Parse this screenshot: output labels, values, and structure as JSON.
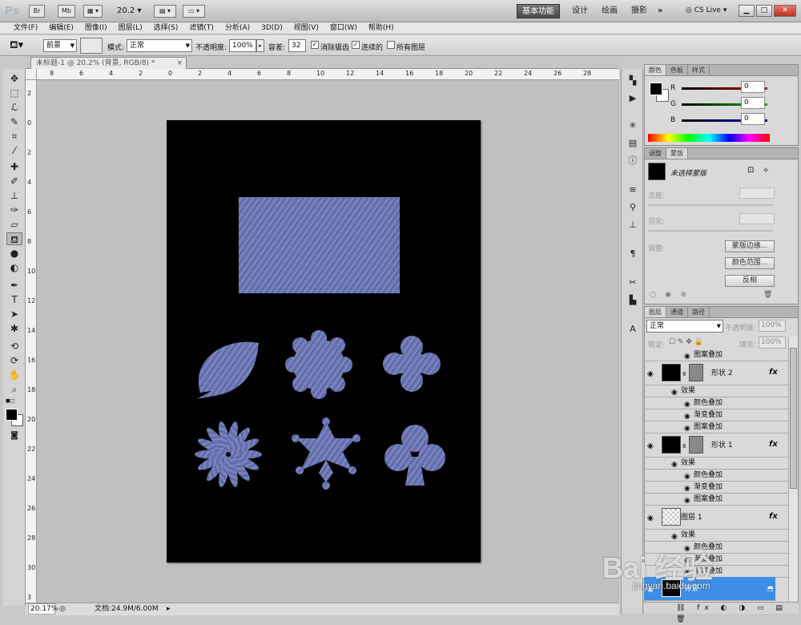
{
  "titlebar": {
    "app_logo": "Ps",
    "br_label": "Br",
    "mb_label": "Mb",
    "zoom_value": "20.2",
    "workspaces": [
      "基本功能",
      "设计",
      "绘画",
      "摄影"
    ],
    "more": "»",
    "cs_live": "CS Live",
    "window_controls": [
      "▁",
      "□",
      "✕"
    ]
  },
  "menubar": {
    "items": [
      "文件(F)",
      "编辑(E)",
      "图像(I)",
      "图层(L)",
      "选择(S)",
      "滤镜(T)",
      "分析(A)",
      "3D(D)",
      "视图(V)",
      "窗口(W)",
      "帮助(H)"
    ]
  },
  "options": {
    "fill_source": "前景",
    "mode_label": "模式:",
    "mode_value": "正常",
    "opacity_label": "不透明度:",
    "opacity_value": "100%",
    "tolerance_label": "容差:",
    "tolerance_value": "32",
    "antialias_label": "消除锯齿",
    "contiguous_label": "连续的",
    "all_layers_label": "所有图层"
  },
  "document_tab": {
    "title": "未标题-1 @ 20.2% (背景, RGB/8) *",
    "close": "×"
  },
  "ruler": {
    "h_labels": [
      "8",
      "6",
      "4",
      "2",
      "0",
      "2",
      "4",
      "6",
      "8",
      "10",
      "12",
      "14",
      "16",
      "18",
      "20",
      "22",
      "24",
      "26",
      "28"
    ],
    "v_labels": [
      "2",
      "0",
      "2",
      "4",
      "6",
      "8",
      "10",
      "12",
      "14",
      "16",
      "18",
      "20",
      "22",
      "24",
      "26",
      "28",
      "30",
      "3"
    ]
  },
  "status": {
    "zoom": "20.17%",
    "doc_info": "文档:24.9M/6.00M"
  },
  "color_panel": {
    "tabs": [
      "颜色",
      "色板",
      "样式"
    ],
    "channels": [
      {
        "name": "R",
        "value": "0",
        "color": "#c00000"
      },
      {
        "name": "G",
        "value": "0",
        "color": "#00b000"
      },
      {
        "name": "B",
        "value": "0",
        "color": "#0000c0"
      }
    ]
  },
  "masks_panel": {
    "tabs": [
      "调整",
      "蒙版"
    ],
    "no_mask": "未选择蒙版",
    "density_label": "浓度:",
    "feather_label": "羽化:",
    "refine_label": "调整:",
    "edge_button": "蒙版边缘...",
    "color_range_button": "颜色范围...",
    "invert_button": "反相"
  },
  "layers_panel": {
    "tabs": [
      "图层",
      "通道",
      "路径"
    ],
    "blend_mode": "正常",
    "opacity_label": "不透明度:",
    "opacity_value": "100%",
    "lock_label": "锁定:",
    "fill_label": "填充:",
    "fill_value": "100%",
    "fx": "fx",
    "rows": {
      "top_pattern": "图案叠加",
      "shape2": "形状 2",
      "shape2_effects": "效果",
      "shape2_color": "颜色叠加",
      "shape2_gradient": "渐变叠加",
      "shape2_pattern": "图案叠加",
      "shape1": "形状 1",
      "shape1_effects": "效果",
      "shape1_color": "颜色叠加",
      "shape1_gradient": "渐变叠加",
      "shape1_pattern": "图案叠加",
      "layer1": "图层 1",
      "layer1_effects": "效果",
      "layer1_color": "颜色叠加",
      "layer1_gradient": "渐变叠加",
      "layer1_pattern": "图案叠加",
      "background": "背景"
    }
  },
  "watermark": {
    "text": "Bai 经验",
    "url": "jingyan.baidu.com"
  }
}
